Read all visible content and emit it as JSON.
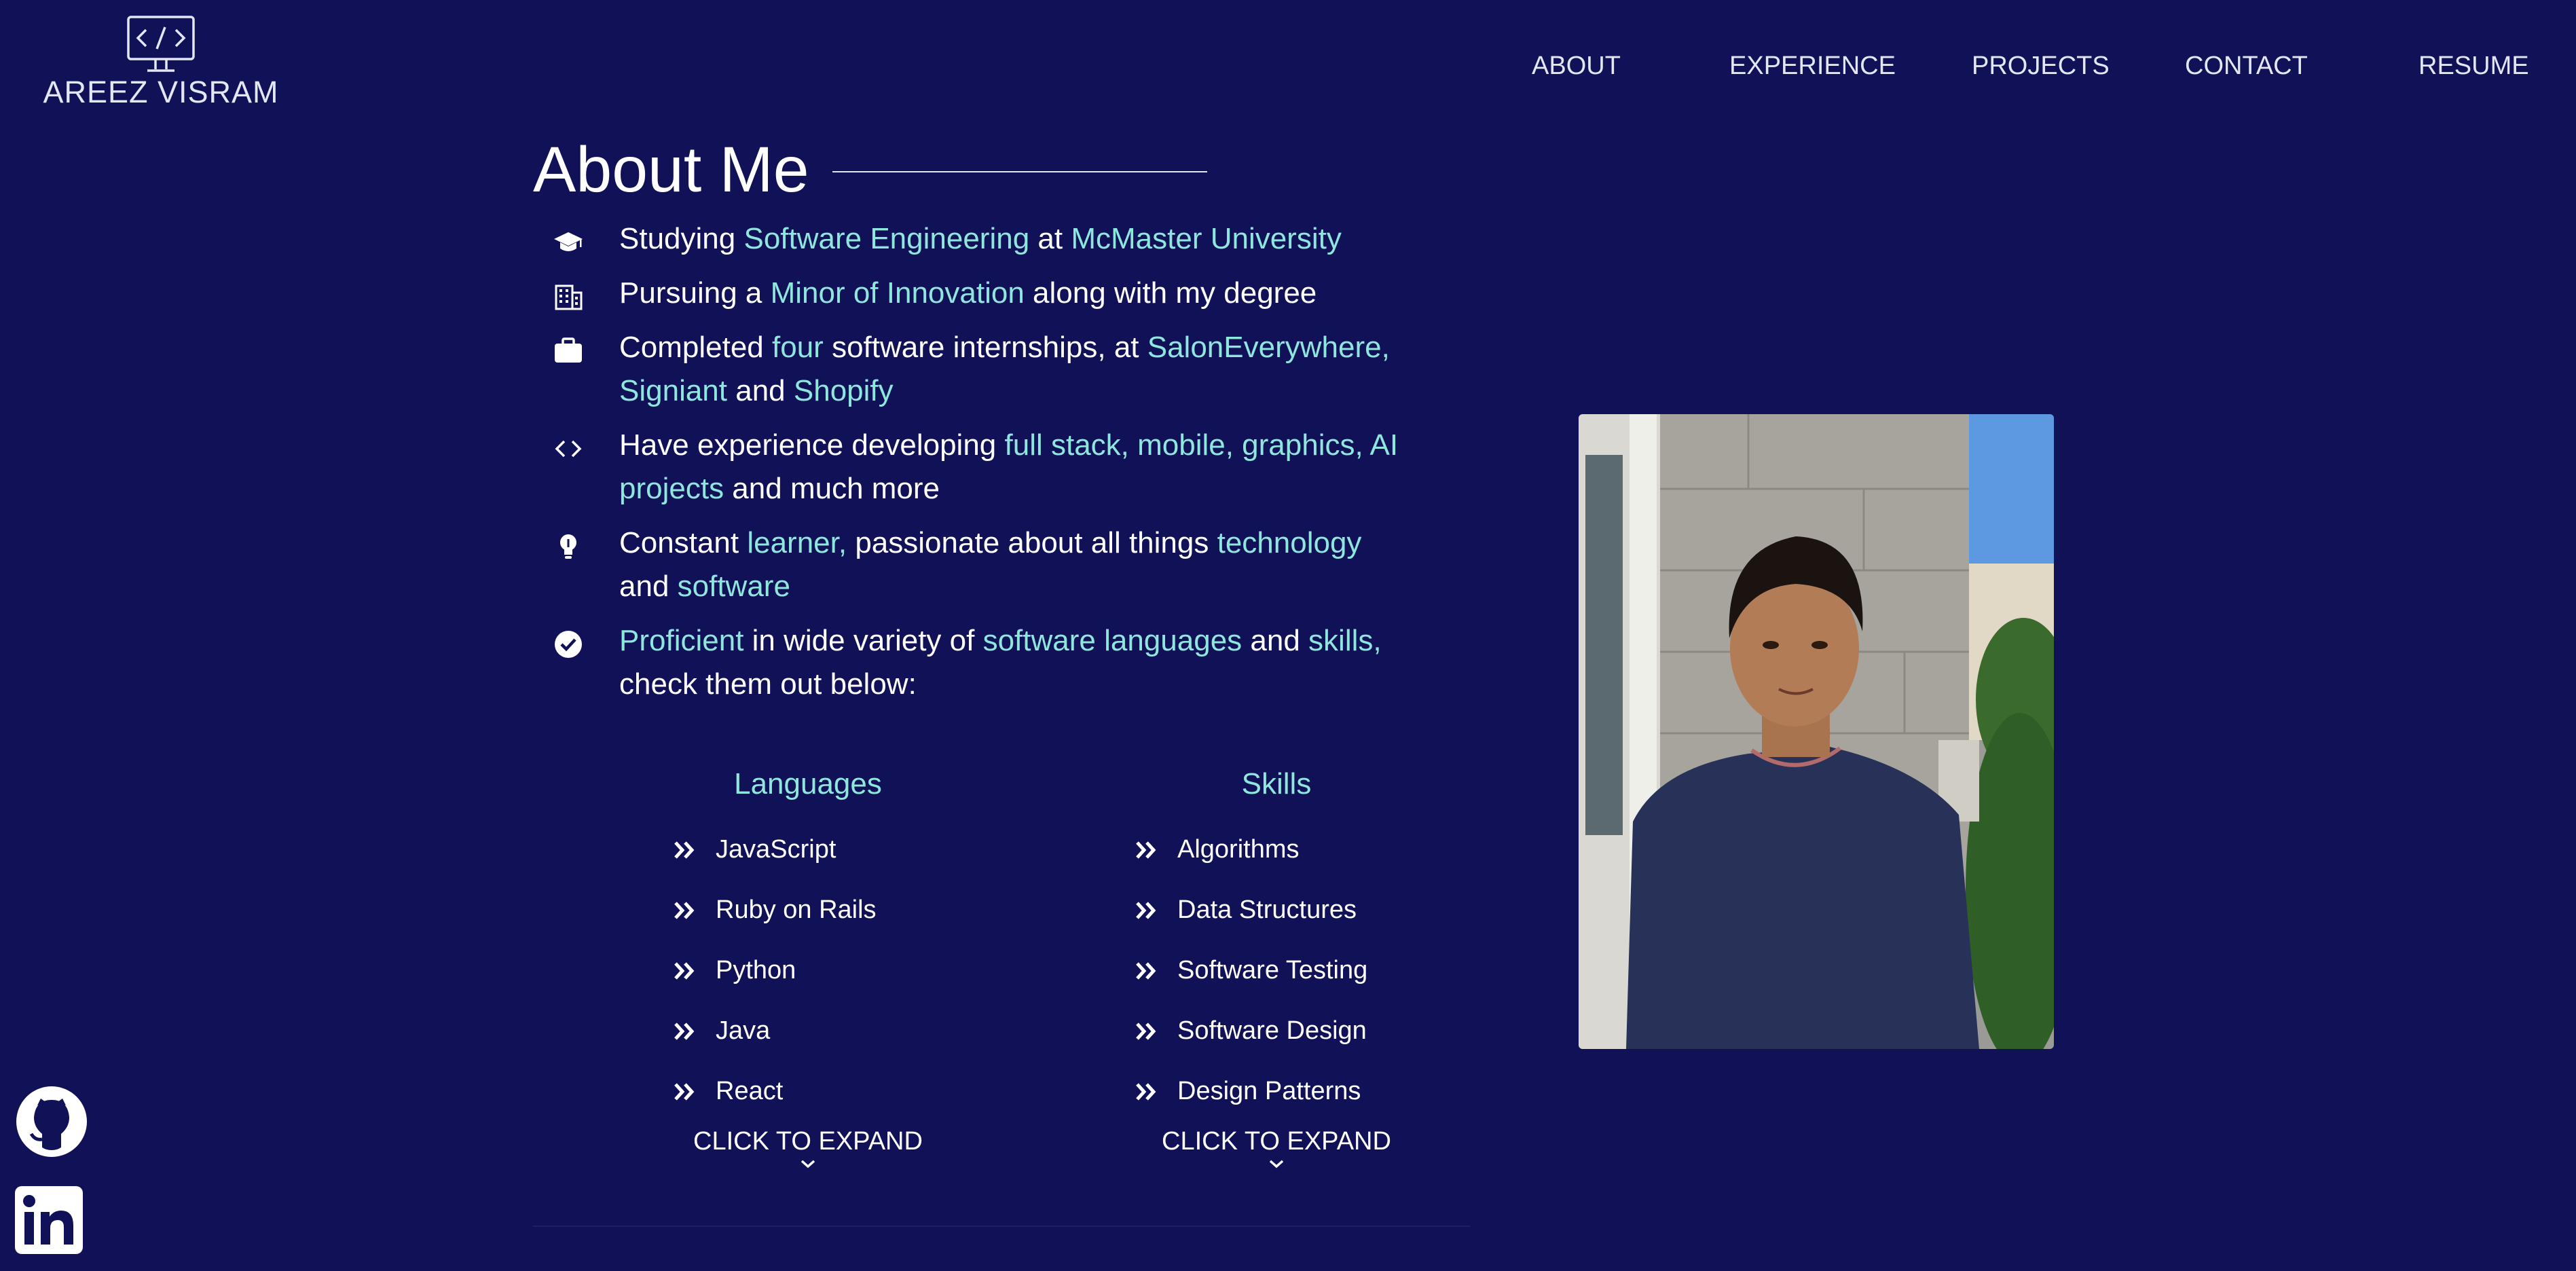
{
  "logo": {
    "name": "AREEZ VISRAM",
    "icon": "code-monitor-icon"
  },
  "nav": [
    {
      "label": "ABOUT"
    },
    {
      "label": "EXPERIENCE"
    },
    {
      "label": "PROJECTS"
    },
    {
      "label": "CONTACT"
    },
    {
      "label": "RESUME"
    }
  ],
  "about": {
    "title": "About Me",
    "facts": [
      {
        "icon": "graduation-cap-icon",
        "parts": [
          "Studying ",
          "Software Engineering",
          " at ",
          "McMaster University"
        ]
      },
      {
        "icon": "building-icon",
        "parts": [
          "Pursuing a ",
          "Minor of Innovation",
          " along with my degree"
        ]
      },
      {
        "icon": "briefcase-icon",
        "parts": [
          "Completed ",
          "four",
          " software internships, at ",
          "SalonEverywhere, Signiant",
          " and ",
          "Shopify"
        ]
      },
      {
        "icon": "code-brackets-icon",
        "parts": [
          "Have experience developing ",
          "full stack, mobile, graphics, AI projects",
          " and much more"
        ]
      },
      {
        "icon": "lightbulb-icon",
        "parts": [
          "Constant ",
          "learner,",
          " passionate about all things ",
          "technology",
          " and ",
          "software"
        ]
      },
      {
        "icon": "check-circle-icon",
        "parts": [
          "",
          "Proficient",
          " in wide variety of ",
          "software languages",
          " and ",
          "skills,",
          " check them out below:"
        ]
      }
    ],
    "languages": {
      "heading": "Languages",
      "items": [
        "JavaScript",
        "Ruby on Rails",
        "Python",
        "Java",
        "React"
      ],
      "expand_label": "CLICK TO EXPAND"
    },
    "skills": {
      "heading": "Skills",
      "items": [
        "Algorithms",
        "Data Structures",
        "Software Testing",
        "Software Design",
        "Design Patterns"
      ],
      "expand_label": "CLICK TO EXPAND"
    }
  },
  "photo": {
    "alt": "portrait-photo"
  },
  "social": [
    {
      "icon": "github-icon"
    },
    {
      "icon": "linkedin-icon"
    }
  ],
  "colors": {
    "background": "#101157",
    "accent": "#8fe6dd",
    "text": "#ffffff",
    "nav_text": "#e3e6f3"
  }
}
